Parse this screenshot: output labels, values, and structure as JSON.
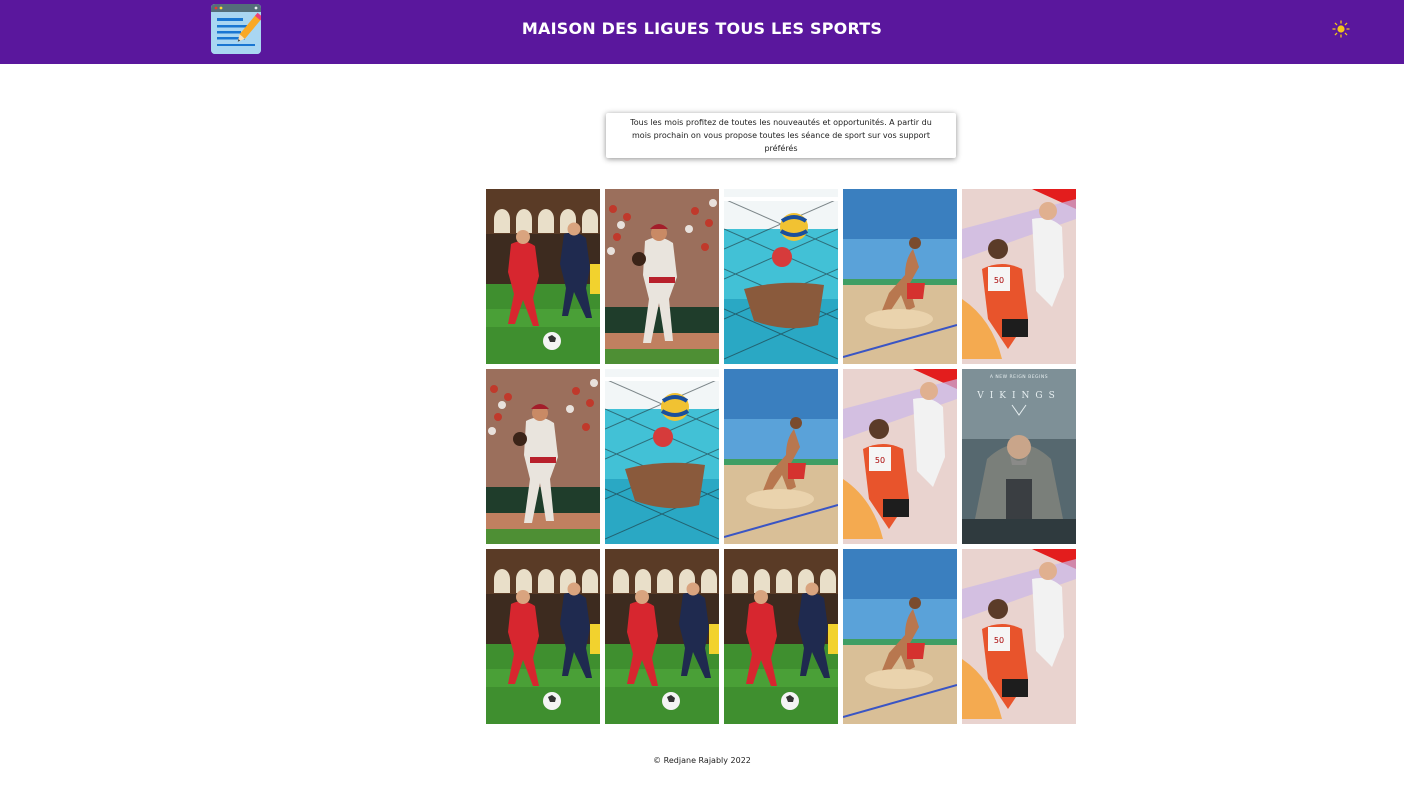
{
  "header": {
    "title": "MAISON DES LIGUES TOUS LES SPORTS",
    "logo_icon": "notepad-pencil-icon",
    "theme_toggle_icon": "sun-icon",
    "background_color": "#5a179d"
  },
  "intro": {
    "text": "Tous les mois profitez de toutes les nouveautés et opportunités. A partir du mois prochain on vous propose toutes les séance de sport sur vos support préférés"
  },
  "gallery": {
    "tiles": [
      {
        "subject": "football"
      },
      {
        "subject": "baseball"
      },
      {
        "subject": "water-polo"
      },
      {
        "subject": "beach-soccer"
      },
      {
        "subject": "athletics"
      },
      {
        "subject": "baseball"
      },
      {
        "subject": "water-polo"
      },
      {
        "subject": "beach-soccer"
      },
      {
        "subject": "athletics"
      },
      {
        "subject": "vikings-poster",
        "tagline": "A NEW REIGN BEGINS",
        "title": "VIKINGS"
      },
      {
        "subject": "football"
      },
      {
        "subject": "football"
      },
      {
        "subject": "football"
      },
      {
        "subject": "beach-soccer"
      },
      {
        "subject": "athletics"
      }
    ]
  },
  "footer": {
    "copyright": "© Redjane Rajably 2022"
  }
}
